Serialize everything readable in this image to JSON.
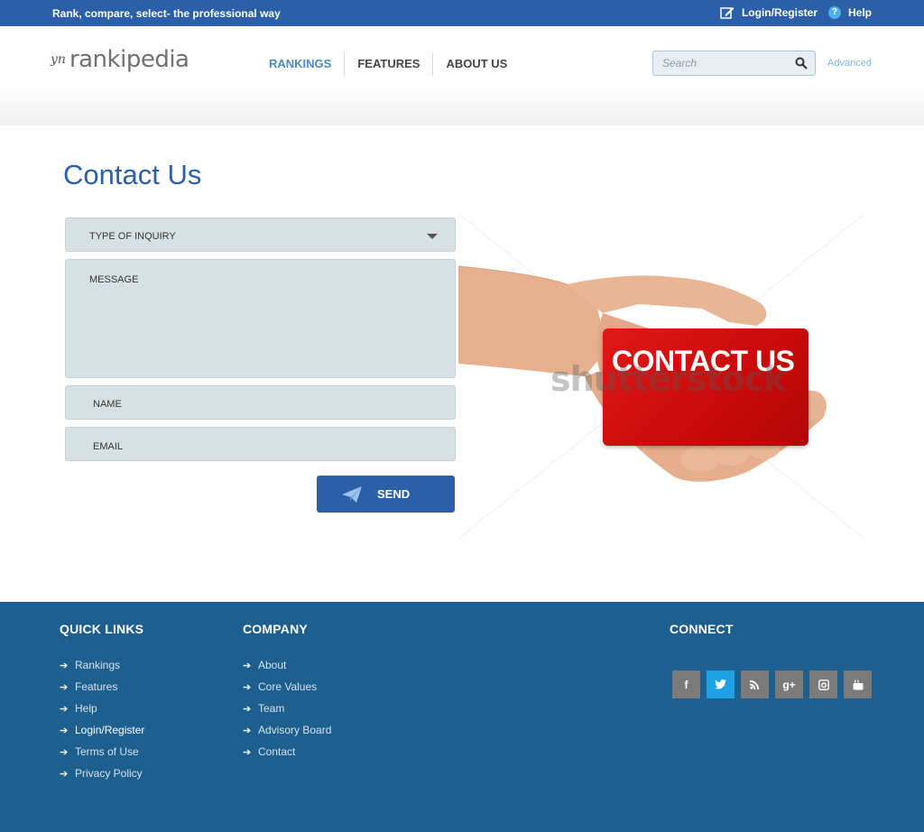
{
  "topbar": {
    "tagline": "Rank, compare, select- the professional way",
    "login_label": "Login/Register",
    "help_label": "Help"
  },
  "header": {
    "logo_mark": "yn",
    "logo_text": "rankipedia",
    "nav": [
      {
        "label": "RANKINGS",
        "active": true
      },
      {
        "label": "FEATURES",
        "active": false
      },
      {
        "label": "ABOUT US",
        "active": false
      }
    ],
    "search_placeholder": "Search",
    "advanced_label": "Advanced"
  },
  "main": {
    "title": "Contact Us",
    "form": {
      "inquiry_label": "TYPE OF INQUIRY",
      "message_label": "MESSAGE",
      "name_label": "NAME",
      "email_label": "EMAIL",
      "send_label": "SEND"
    },
    "hero": {
      "card_text": "CONTACT US",
      "watermark": "shutterstock"
    }
  },
  "footer": {
    "quick_links": {
      "heading": "QUICK LINKS",
      "items": [
        "Rankings",
        "Features",
        "Help",
        "Login/Register",
        "Terms of Use",
        "Privacy Policy"
      ]
    },
    "company": {
      "heading": "COMPANY",
      "items": [
        "About",
        "Core Values",
        "Team",
        "Advisory Board",
        "Contact"
      ]
    },
    "connect": {
      "heading": "CONNECT",
      "icons": [
        "facebook-icon",
        "twitter-icon",
        "rss-icon",
        "google-plus-icon",
        "instagram-icon",
        "youtube-icon"
      ]
    }
  },
  "colors": {
    "brand_blue": "#2b5fa8",
    "footer_blue": "#1d5f8f",
    "field_bg": "#d7e1e4",
    "card_red": "#d41010",
    "twitter_blue": "#1da1e2"
  }
}
